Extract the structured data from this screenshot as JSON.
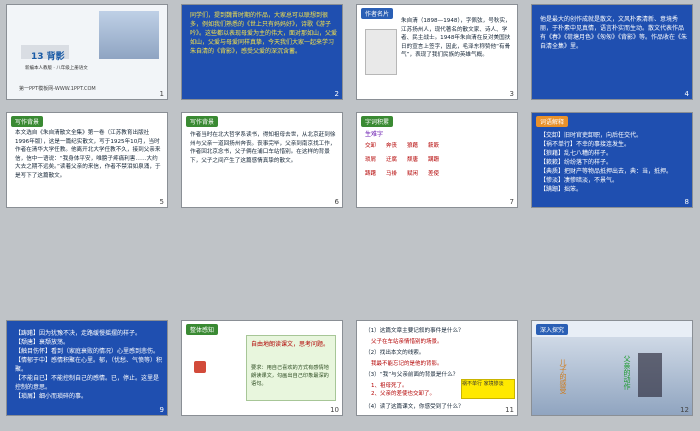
{
  "slides": [
    {
      "id": 1,
      "title": "13 背影",
      "subtitle": "新编本人教版 · 八年级上册语文",
      "footer": "第一PPT模板网-WWW.1PPT.COM",
      "num": "1"
    },
    {
      "id": 2,
      "text": "同学们，提到魏晋时期的作品，大家总可以联想到很多，例如我们熟悉的《世上只有妈妈好》，诗歌《游子吟》。这些都以表现母爱为主的伟大，面对那如山，父爱如山，父爱与母爱同样真挚，今天我们大家一起来学习朱自清的《背影》，感受父爱的深沉含蓄。",
      "num": "2"
    },
    {
      "id": 3,
      "tag": "作者名片",
      "text": "朱自清（1898—1948），字佩弦，号秋实，江苏扬州人，现代著名的散文家、诗人、学者、民主战士。1948年朱自清在反对美国扶日的宣言上签字，因此，毛泽东称赞他“有骨气”，表现了我们民族的英雄气概。",
      "num": "3"
    },
    {
      "id": 4,
      "text": "他是最大的创作成就是散文，文风朴素清新、意境秀丽，于朴素中见真情，语言朴实而生动。散文代表作品有《春》《荷塘月色》《匆匆》《背影》等。作品收在《朱自清全集》里。",
      "num": "4"
    },
    {
      "id": 5,
      "tag": "写作背景",
      "text": "本文选自《朱自清散文全集》第一卷（江苏教育出版社1996年版），这是一篇纪实散文，写于1925年10月，当时作者在清华大学任教。他离开北大学任教不久，接到父亲来信，信中一语说：“我身体平安，唯膀子疼痛利害……大约大去之期不远矣。”读着父亲的来信，作者不禁泪如泉涌，于是写下了这篇散文。",
      "num": "5"
    },
    {
      "id": 6,
      "tag": "写作背景",
      "text": "作者当时在北大哲学系读书，得知祖母去世，从北京赶到徐州与父亲一道回扬州奔丧。丧事完毕，父亲到南京找工作，作者回北京念书，父子俩在浦口车站惜别。在这样的背景下，父子之间产生了这篇感情真挚的散文。",
      "num": "6"
    },
    {
      "id": 7,
      "tag": "字词积累",
      "subtag": "生难字",
      "words": [
        "交卸",
        "奔丧",
        "狼藉",
        "簌簌",
        "琐屑",
        "迂腐",
        "颓唐",
        "蹒跚",
        "踌躇",
        "马褂",
        "赋闲",
        "差使",
        "举箸",
        "蹒跚",
        "踊跃"
      ],
      "num": "7"
    },
    {
      "id": 8,
      "tag": "词语解释",
      "items": [
        "【交卸】旧时官吏卸职，向后任交代。",
        "【祸不单行】不幸的事接连发生。",
        "【狼藉】乱七八糟的样子。",
        "【簌簌】纷纷落下的样子。",
        "【典质】把财产等物品抵押出去，典：当，抵押。",
        "【惨淡】凄惨暗淡，不景气。",
        "【蹒跚】拙笨。"
      ],
      "num": "8"
    },
    {
      "id": 9,
      "items": [
        "【踌躇】因为犹豫不决，走路缓慢摇摆的样子。",
        "【颓唐】衰颓放荡。",
        "【触目伤怀】看到（家庭衰败的情况）心里感到悲伤。",
        "【情郁于中】感情积聚在心里。郁，（忧愁、气愤等）积聚。",
        "【不能自已】不能控制自己的感情。已，停止。这里是控制的意思。",
        "【琐屑】细小而琐碎的事。"
      ],
      "num": "9"
    },
    {
      "id": 10,
      "tag": "整体感知",
      "lead": "自由地朗读课文，思考问题。",
      "body": "要求：用自己喜欢的方式有感情地朗读课文，勾画出自己印象最深的语句。",
      "num": "10"
    },
    {
      "id": 11,
      "q1": "（1）这篇文章主要记叙的事件是什么？",
      "a1": "父子在车站亲情惜别的场景。",
      "q2": "（2）找出本文的线索。",
      "a2": "我最不能忘记的是他的背影。",
      "q3": "（3）“我”与父亲前面的背景是什么？",
      "a3a": "1、祖母死了。",
      "a3b": "2、父亲的差使也交卸了。",
      "box": "祸不单行 家境惨淡",
      "q4": "（4）读了这篇课文，你感受到了什么？",
      "num": "11"
    },
    {
      "id": 12,
      "tag": "深入探究",
      "left": "儿子的感受",
      "right": "父亲的动作",
      "num": "12"
    }
  ],
  "colors": {
    "blue": "#1f4fb0",
    "yellow": "#f6e34a",
    "green": "#3a8a33",
    "orange": "#e9912a",
    "red": "#b30000"
  }
}
